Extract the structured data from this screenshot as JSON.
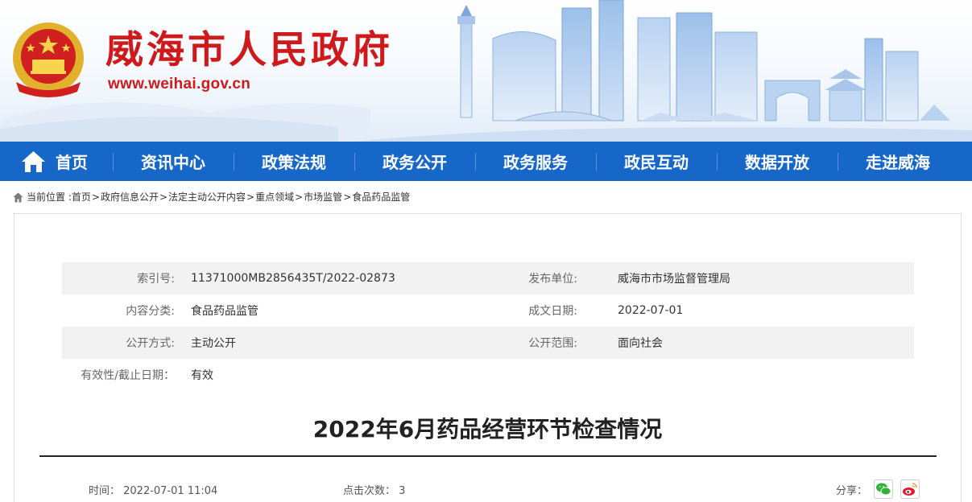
{
  "header": {
    "site_title": "威海市人民政府",
    "site_url": "www.weihai.gov.cn",
    "emblem_icon": "national-emblem-icon",
    "brand_color": "#cf1a1b",
    "nav_color": "#1767c9"
  },
  "nav": {
    "items": [
      {
        "label": "首页",
        "icon": "home-icon"
      },
      {
        "label": "资讯中心"
      },
      {
        "label": "政策法规"
      },
      {
        "label": "政务公开"
      },
      {
        "label": "政务服务"
      },
      {
        "label": "政民互动"
      },
      {
        "label": "数据开放"
      },
      {
        "label": "走进威海"
      }
    ]
  },
  "breadcrumb": {
    "icon": "home-icon",
    "prefix": "当前位置 :",
    "items": [
      "首页",
      "政府信息公开",
      "法定主动公开内容",
      "重点领域",
      "市场监管",
      "食品药品监管"
    ],
    "separator": ">"
  },
  "meta": {
    "index_no_label": "索引号:",
    "index_no": "11371000MB2856435T/2022-02873",
    "publisher_label": "发布单位:",
    "publisher": "威海市市场监督管理局",
    "category_label": "内容分类:",
    "category": "食品药品监管",
    "date_label": "成文日期:",
    "date": "2022-07-01",
    "open_method_label": "公开方式:",
    "open_method": "主动公开",
    "open_scope_label": "公开范围:",
    "open_scope": "面向社会",
    "validity_label": "有效性/截止日期：",
    "validity": "有效"
  },
  "article": {
    "title": "2022年6月药品经营环节检查情况",
    "time_text": "时间： 2022-07-01 11:04",
    "clicks_text": "点击次数： 3",
    "share_label": "分享：",
    "share_icons": [
      "wechat-icon",
      "weibo-icon"
    ]
  }
}
